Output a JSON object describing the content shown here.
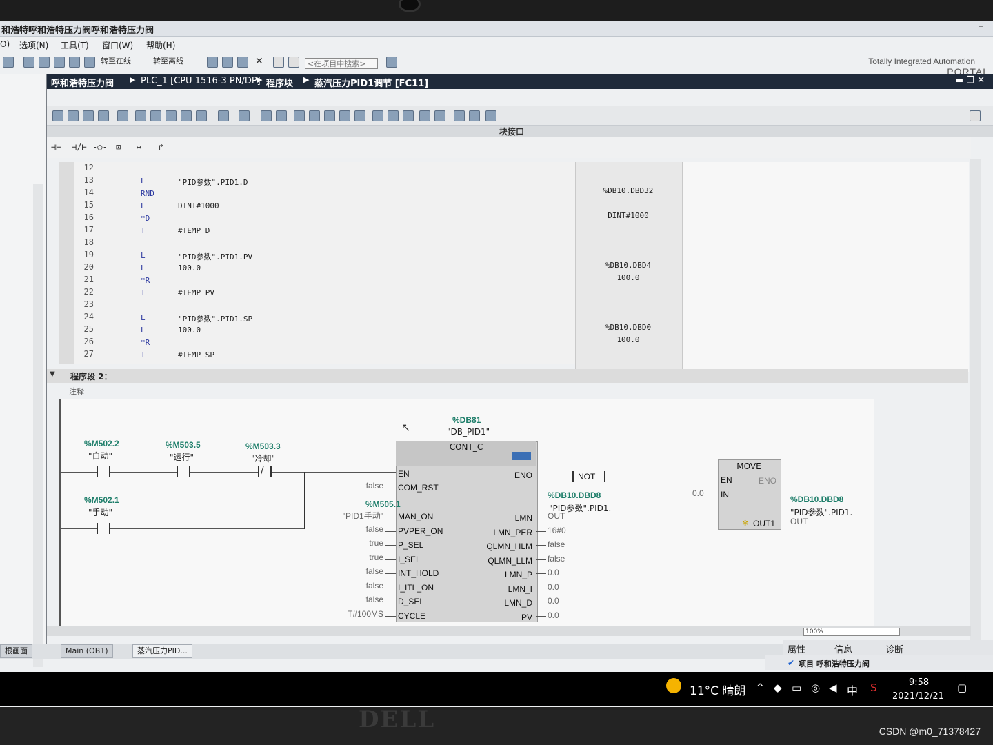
{
  "window": {
    "title": "和浩特呼和浩特压力阀呼和浩特压力阀",
    "minimize": "–"
  },
  "menu": [
    "O)",
    "选项(N)",
    "工具(T)",
    "窗口(W)",
    "帮助(H)"
  ],
  "toolbar": {
    "go_online": "转至在线",
    "go_offline": "转至离线",
    "search_placeholder": "<在项目中搜索>",
    "brand_line1": "Totally Integrated Automation",
    "brand_line2": "PORTAL"
  },
  "breadcrumb": [
    "呼和浩特压力阀",
    "PLC_1 [CPU 1516-3 PN/DP]",
    "程序块",
    "蒸汽压力PID1调节 [FC11]"
  ],
  "editor": {
    "block_interface_label": "块接口",
    "ladder_buttons": [
      "⊣⊢",
      "⊣/⊢",
      "-○-",
      "⊡",
      "↦",
      "↱"
    ]
  },
  "code_lines": [
    {
      "no": "12",
      "op": "",
      "operand": ""
    },
    {
      "no": "13",
      "op": "L",
      "operand": "\"PID参数\".PID1.D"
    },
    {
      "no": "14",
      "op": "RND",
      "operand": ""
    },
    {
      "no": "15",
      "op": "L",
      "operand": "DINT#1000"
    },
    {
      "no": "16",
      "op": "*D",
      "operand": ""
    },
    {
      "no": "17",
      "op": "T",
      "operand": "#TEMP_D"
    },
    {
      "no": "18",
      "op": "",
      "operand": ""
    },
    {
      "no": "19",
      "op": "L",
      "operand": "\"PID参数\".PID1.PV"
    },
    {
      "no": "20",
      "op": "L",
      "operand": "100.0"
    },
    {
      "no": "21",
      "op": "*R",
      "operand": ""
    },
    {
      "no": "22",
      "op": "T",
      "operand": "#TEMP_PV"
    },
    {
      "no": "23",
      "op": "",
      "operand": ""
    },
    {
      "no": "24",
      "op": "L",
      "operand": "\"PID参数\".PID1.SP"
    },
    {
      "no": "25",
      "op": "L",
      "operand": "100.0"
    },
    {
      "no": "26",
      "op": "*R",
      "operand": ""
    },
    {
      "no": "27",
      "op": "T",
      "operand": "#TEMP_SP"
    }
  ],
  "addresses": [
    "%DB10.DBD32",
    "DINT#1000",
    "%DB10.DBD4",
    "100.0",
    "%DB10.DBD0",
    "100.0"
  ],
  "network2": {
    "title": "程序段 2：",
    "comment": "注释",
    "contacts": [
      {
        "addr": "%M502.2",
        "name": "\"自动\""
      },
      {
        "addr": "%M503.5",
        "name": "\"运行\""
      },
      {
        "addr": "%M503.3",
        "name": "\"冷却\""
      },
      {
        "addr": "%M502.1",
        "name": "\"手动\""
      }
    ],
    "instance_db": {
      "addr": "%DB81",
      "name": "\"DB_PID1\""
    },
    "block_type": "CONT_C",
    "inputs": [
      {
        "pin": "EN",
        "value": ""
      },
      {
        "pin": "COM_RST",
        "value": "false"
      },
      {
        "pin": "MAN_ON",
        "value": "\"PID1手动\"",
        "addr": "%M505.1"
      },
      {
        "pin": "PVPER_ON",
        "value": "false"
      },
      {
        "pin": "P_SEL",
        "value": "true"
      },
      {
        "pin": "I_SEL",
        "value": "true"
      },
      {
        "pin": "INT_HOLD",
        "value": "false"
      },
      {
        "pin": "I_ITL_ON",
        "value": "false"
      },
      {
        "pin": "D_SEL",
        "value": "false"
      },
      {
        "pin": "CYCLE",
        "value": "T#100MS"
      }
    ],
    "outputs": [
      {
        "pin": "ENO",
        "value": ""
      },
      {
        "pin": "LMN",
        "value": "OUT"
      },
      {
        "pin": "LMN_PER",
        "value": "16#0"
      },
      {
        "pin": "QLMN_HLM",
        "value": "false"
      },
      {
        "pin": "QLMN_LLM",
        "value": "false"
      },
      {
        "pin": "LMN_P",
        "value": "0.0"
      },
      {
        "pin": "LMN_I",
        "value": "0.0"
      },
      {
        "pin": "LMN_D",
        "value": "0.0"
      },
      {
        "pin": "PV",
        "value": "0.0"
      }
    ],
    "lmn_target": {
      "addr": "%DB10.DBD8",
      "name": "\"PID参数\".PID1."
    },
    "not_label": "NOT",
    "move": {
      "title": "MOVE",
      "en": "EN",
      "eno": "ENO",
      "in": "IN",
      "in_value": "0.0",
      "out1": "OUT1",
      "target_addr": "%DB10.DBD8",
      "target_name": "\"PID参数\".PID1.",
      "target_suffix": "OUT"
    }
  },
  "zoom": "100%",
  "inspector_tabs": [
    "属性",
    "信息",
    "诊断"
  ],
  "editor_tabs": [
    "根画面",
    "Main (OB1)",
    "蒸汽压力PID..."
  ],
  "status": "项目 呼和浩特压力阀",
  "taskbar": {
    "weather": "11°C  晴朗",
    "ime": "中",
    "time": "9:58",
    "date": "2021/12/21"
  },
  "hardware": {
    "brand": "DELL"
  },
  "watermark": "CSDN @m0_71378427"
}
